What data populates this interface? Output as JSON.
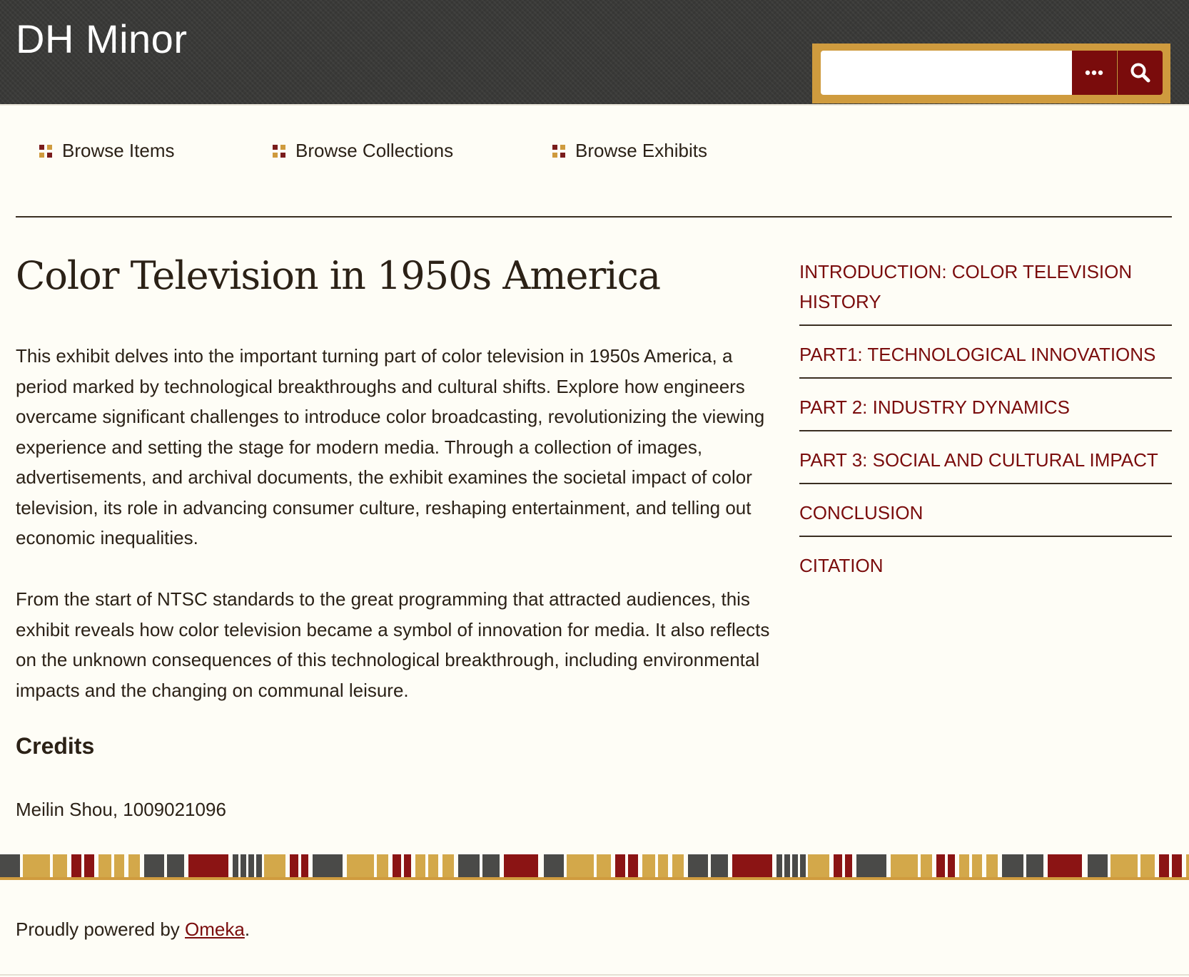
{
  "header": {
    "site_title": "DH Minor",
    "search": {
      "value": "",
      "placeholder": ""
    },
    "options_icon": "ellipsis-icon",
    "search_icon": "search-icon"
  },
  "nav": {
    "items": [
      {
        "label": "Browse Items"
      },
      {
        "label": "Browse Collections"
      },
      {
        "label": "Browse Exhibits"
      }
    ]
  },
  "exhibit": {
    "title": "Color Television in 1950s America",
    "paragraphs": [
      "This exhibit delves into the important turning part of color television in 1950s America, a period marked by technological breakthroughs and cultural shifts. Explore how engineers overcame significant challenges to introduce color broadcasting, revolutionizing the viewing experience and setting the stage for modern media. Through a collection of images, advertisements, and archival documents, the exhibit examines the societal impact of color television, its role in advancing consumer culture, reshaping entertainment, and telling out economic inequalities.",
      "From the start of NTSC standards to the great programming that attracted audiences, this exhibit reveals how color television became a symbol of innovation for media. It also reflects on the unknown consequences of this technological breakthrough, including environmental impacts and the changing on communal leisure."
    ],
    "credits_heading": "Credits",
    "credits": "Meilin Shou, 1009021096"
  },
  "toc": {
    "items": [
      {
        "label": "INTRODUCTION: COLOR TELEVISION HISTORY"
      },
      {
        "label": "PART1: TECHNOLOGICAL INNOVATIONS"
      },
      {
        "label": "PART 2: INDUSTRY DYNAMICS"
      },
      {
        "label": "PART 3: SOCIAL AND CULTURAL IMPACT"
      },
      {
        "label": "CONCLUSION"
      },
      {
        "label": "CITATION"
      }
    ]
  },
  "footer": {
    "prefix": "Proudly powered by ",
    "link": "Omeka",
    "suffix": "."
  },
  "colors": {
    "accent": "#7a0c0c",
    "gold": "#cf9b3e",
    "header_bg": "#3a3a38",
    "page_bg": "#fefdf6",
    "text": "#2b2116"
  }
}
